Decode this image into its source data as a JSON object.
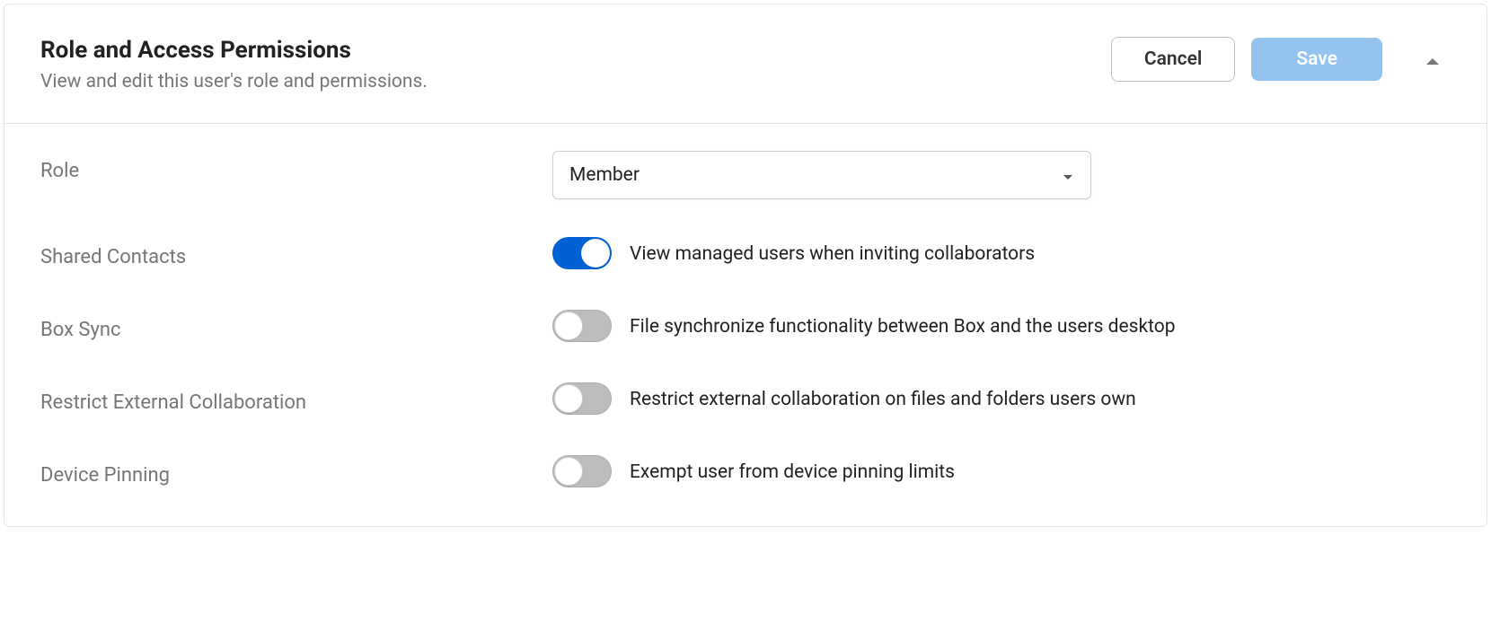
{
  "header": {
    "title": "Role and Access Permissions",
    "subtitle": "View and edit this user's role and permissions.",
    "cancel_label": "Cancel",
    "save_label": "Save"
  },
  "form": {
    "role": {
      "label": "Role",
      "value": "Member"
    },
    "shared_contacts": {
      "label": "Shared Contacts",
      "description": "View managed users when inviting collaborators",
      "enabled": true
    },
    "box_sync": {
      "label": "Box Sync",
      "description": "File synchronize functionality between Box and the users desktop",
      "enabled": false
    },
    "restrict_external": {
      "label": "Restrict External Collaboration",
      "description": "Restrict external collaboration on files and folders users own",
      "enabled": false
    },
    "device_pinning": {
      "label": "Device Pinning",
      "description": "Exempt user from device pinning limits",
      "enabled": false
    }
  }
}
